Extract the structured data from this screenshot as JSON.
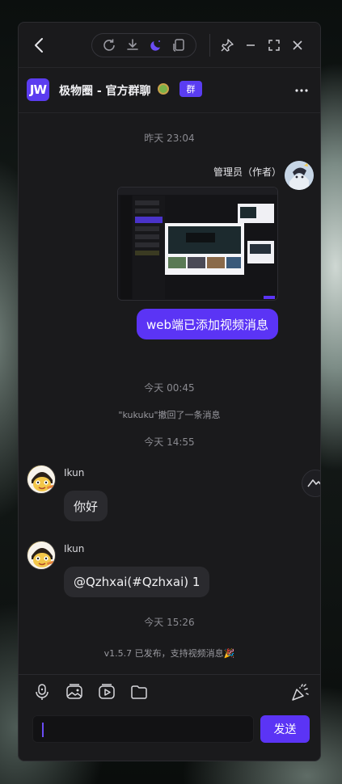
{
  "titlebar": {
    "icons": [
      "back-icon",
      "refresh-icon",
      "download-icon",
      "moon-icon",
      "window-icon",
      "pin-icon",
      "minimize-icon",
      "maximize-icon",
      "close-icon"
    ]
  },
  "chat": {
    "logo_text": "JW",
    "group_name": "极物圈 - 官方群聊",
    "group_badge": "群"
  },
  "messages": {
    "ts1": "昨天 23:04",
    "admin_name": "管理员（作者）",
    "admin_text": "web端已添加视频消息",
    "ts2": "今天 00:45",
    "recall_notice": "\"kukuku\"撤回了一条消息",
    "ts3": "今天 14:55",
    "user1_name": "Ikun",
    "user1_text": "你好",
    "user2_name": "Ikun",
    "user2_text": "@Qzhxai(#Qzhxai) 1",
    "ts4": "今天 15:26",
    "release_notice": "v1.5.7 已发布，支持视频消息🎉"
  },
  "composer": {
    "send_label": "发送",
    "tools": [
      "mic-icon",
      "image-icon",
      "video-icon",
      "folder-icon",
      "party-icon"
    ]
  },
  "colors": {
    "accent": "#5b34f5",
    "window_bg": "#1a1a1c",
    "bubble_other": "#2a2a2e"
  }
}
